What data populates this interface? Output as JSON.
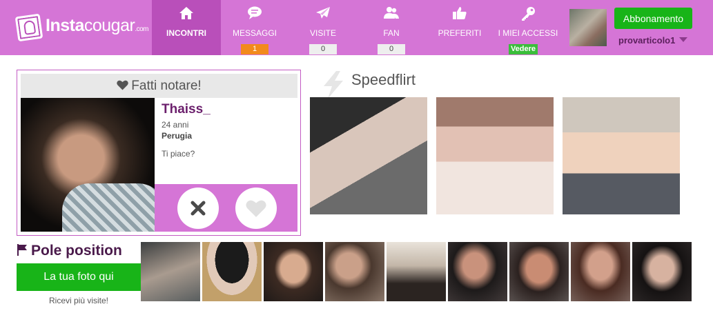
{
  "brand": {
    "name_bold": "Insta",
    "name_light": "cougar",
    "suffix": ".com"
  },
  "nav": {
    "items": [
      {
        "label": "INCONTRI",
        "icon": "home-icon",
        "active": true
      },
      {
        "label": "MESSAGGI",
        "icon": "chat-bubble-icon",
        "count": "1"
      },
      {
        "label": "VISITE",
        "icon": "paper-plane-icon",
        "count": "0"
      },
      {
        "label": "FAN",
        "icon": "users-icon",
        "count": "0"
      },
      {
        "label": "PREFERITI",
        "icon": "thumbs-up-icon"
      },
      {
        "label": "I MIEI ACCESSI",
        "icon": "key-icon",
        "badge": "Vedere"
      }
    ]
  },
  "account": {
    "subscribe_label": "Abbonamento",
    "username": "provarticolo1"
  },
  "featured": {
    "title": "Fatti notare!",
    "name": "Thaiss_",
    "age": "24 anni",
    "city": "Perugia",
    "question": "Ti piace?"
  },
  "speedflirt": {
    "title": "Speedflirt"
  },
  "pole": {
    "title": "Pole position",
    "button_label": "La tua foto qui",
    "hint": "Ricevi più visite!"
  },
  "colors": {
    "nav_bg": "#d575d6",
    "nav_active": "#b94fba",
    "cta_green": "#18b418",
    "counter_orange": "#f28a1c",
    "name_purple": "#6b1f6c"
  }
}
